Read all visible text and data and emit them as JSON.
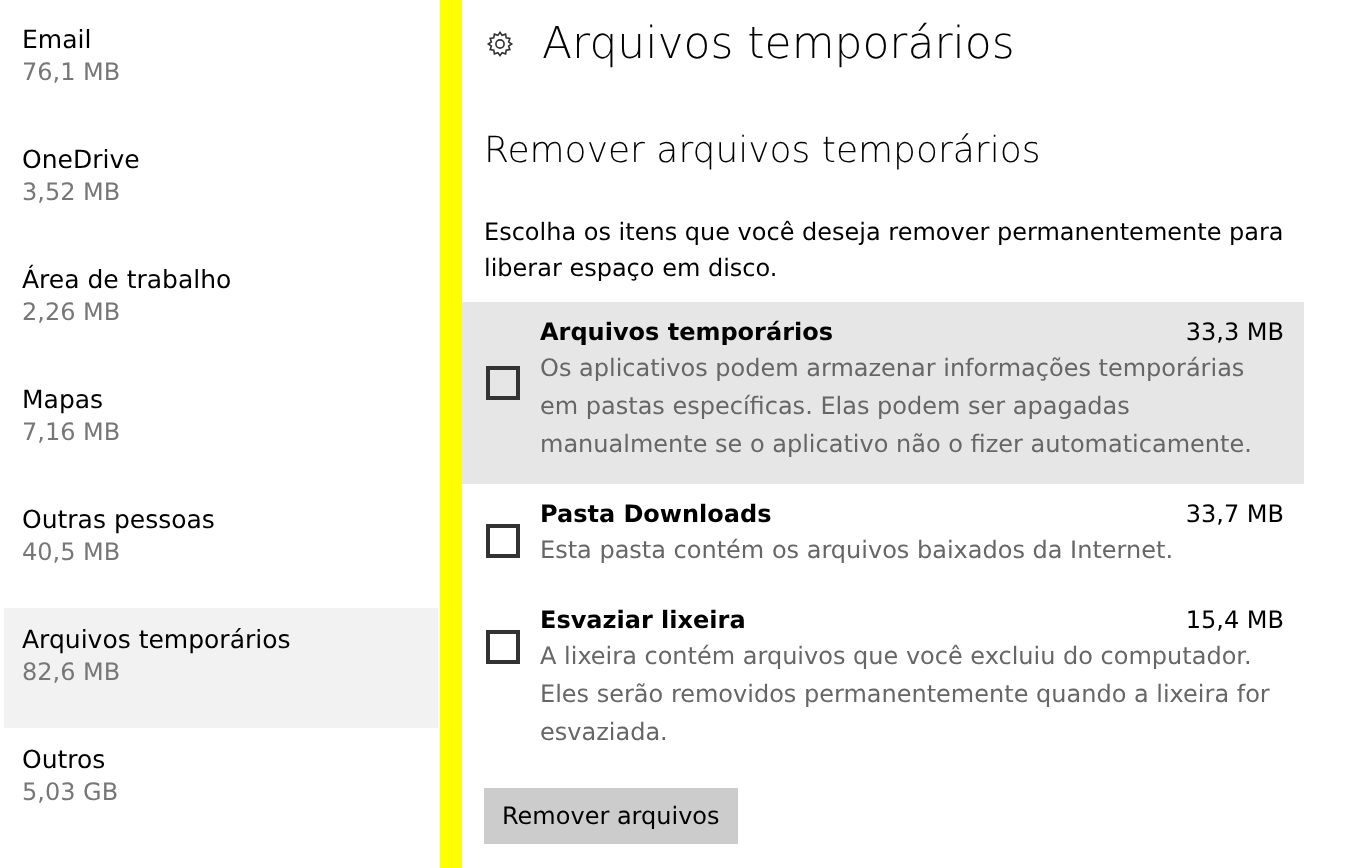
{
  "sidebar": {
    "items": [
      {
        "name": "Email",
        "size": "76,1 MB",
        "selected": false
      },
      {
        "name": "OneDrive",
        "size": "3,52 MB",
        "selected": false
      },
      {
        "name": "Área de trabalho",
        "size": "2,26 MB",
        "selected": false
      },
      {
        "name": "Mapas",
        "size": "7,16 MB",
        "selected": false
      },
      {
        "name": "Outras pessoas",
        "size": "40,5 MB",
        "selected": false
      },
      {
        "name": "Arquivos temporários",
        "size": "82,6 MB",
        "selected": true
      },
      {
        "name": "Outros",
        "size": "5,03 GB",
        "selected": false
      }
    ]
  },
  "page": {
    "title": "Arquivos temporários",
    "subtitle": "Remover arquivos temporários",
    "description": "Escolha os itens que você deseja remover permanentemente para liberar espaço em disco.",
    "options": [
      {
        "name": "Arquivos temporários",
        "size": "33,3 MB",
        "description": "Os aplicativos podem armazenar informações temporárias em pastas específicas. Elas podem ser apagadas manualmente se o aplicativo não o fizer automaticamente.",
        "checked": false,
        "hovered": true
      },
      {
        "name": "Pasta Downloads",
        "size": "33,7 MB",
        "description": "Esta pasta contém os arquivos baixados da Internet.",
        "checked": false,
        "hovered": false
      },
      {
        "name": "Esvaziar lixeira",
        "size": "15,4 MB",
        "description": "A lixeira contém arquivos que você excluiu do computador. Eles serão removidos permanentemente quando a lixeira for esvaziada.",
        "checked": false,
        "hovered": false
      }
    ],
    "button": "Remover arquivos"
  }
}
